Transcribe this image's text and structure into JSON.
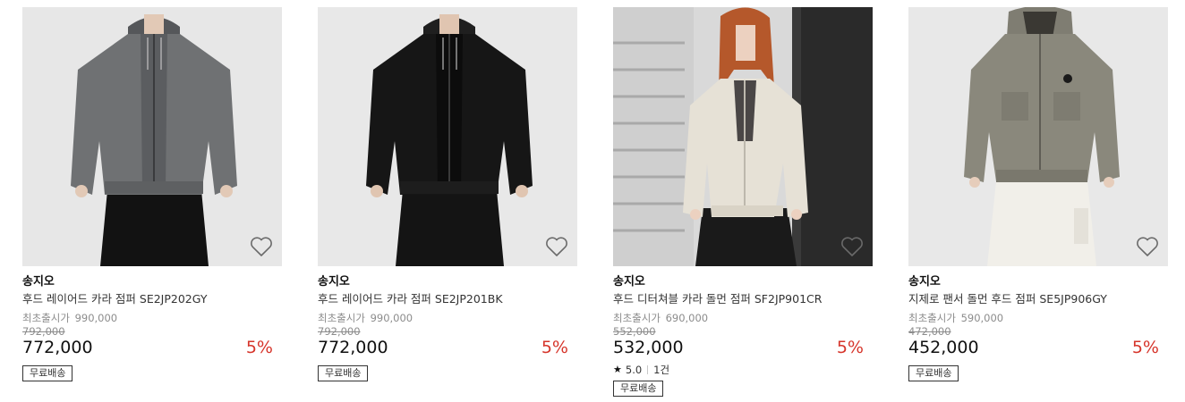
{
  "products": [
    {
      "brand": "송지오",
      "name": "후드 레이어드 카라 점퍼 SE2JP202GY",
      "release_label": "최초출시가",
      "release_price": "990,000",
      "list_price": "792,000",
      "sale_price": "772,000",
      "discount": "5%",
      "badge": "무료배송",
      "jacket_color": "#6f7173",
      "bg_color": "#e7e7e7"
    },
    {
      "brand": "송지오",
      "name": "후드 레이어드 카라 점퍼 SE2JP201BK",
      "release_label": "최초출시가",
      "release_price": "990,000",
      "list_price": "792,000",
      "sale_price": "772,000",
      "discount": "5%",
      "badge": "무료배송",
      "jacket_color": "#161616",
      "bg_color": "#e8e8e8"
    },
    {
      "brand": "송지오",
      "name": "후드 디터쳐블 카라 돌먼 점퍼 SF2JP901CR",
      "release_label": "최초출시가",
      "release_price": "690,000",
      "list_price": "552,000",
      "sale_price": "532,000",
      "discount": "5%",
      "rating_score": "5.0",
      "review_count": "1건",
      "badge": "무료배송",
      "jacket_color": "#e6e1d6",
      "bg_color": "#d9d9d9"
    },
    {
      "brand": "송지오",
      "name": "지제로 팬서 돌먼 후드 점퍼 SE5JP906GY",
      "release_label": "최초출시가",
      "release_price": "590,000",
      "list_price": "472,000",
      "sale_price": "452,000",
      "discount": "5%",
      "badge": "무료배송",
      "jacket_color": "#8a887c",
      "bg_color": "#e8e8e8"
    }
  ],
  "colors": {
    "discount": "#d6352b",
    "muted": "#8c8c8c"
  },
  "icons": {
    "wishlist": "heart-outline-icon",
    "rating": "star-icon"
  }
}
